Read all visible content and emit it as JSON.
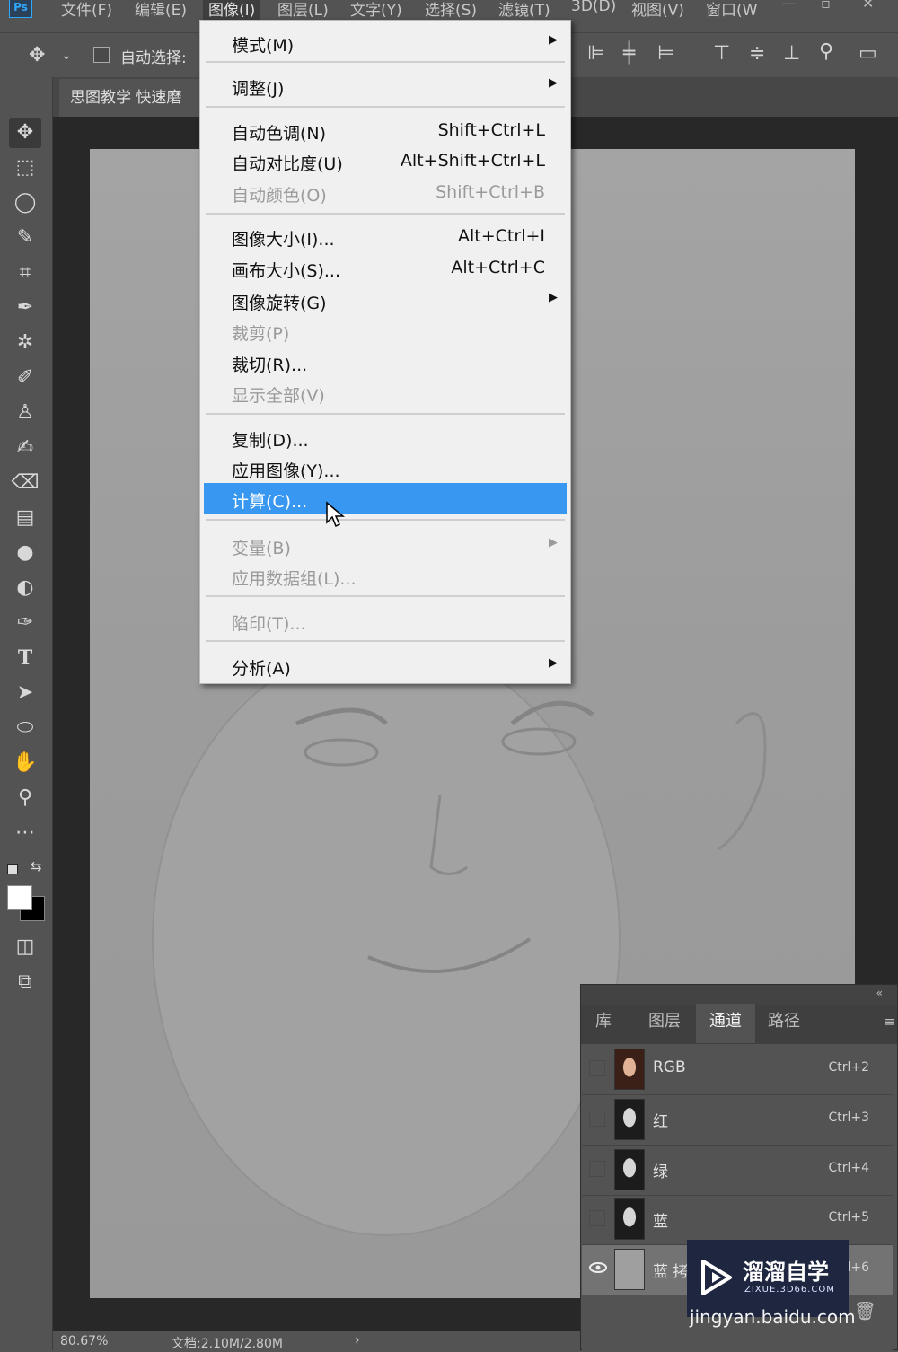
{
  "menubar": {
    "logo": "Ps",
    "items": [
      "文件(F)",
      "编辑(E)",
      "图像(I)",
      "图层(L)",
      "文字(Y)",
      "选择(S)",
      "滤镜(T)",
      "3D(D)",
      "视图(V)",
      "窗口(W"
    ],
    "active_index": 2
  },
  "options_bar": {
    "auto_select_label": "自动选择:"
  },
  "document": {
    "tab_title": "思图教学 快速磨"
  },
  "image_menu": {
    "items": [
      {
        "label": "模式(M)",
        "shortcut": "",
        "submenu": true,
        "disabled": false
      },
      {
        "label": "调整(J)",
        "shortcut": "",
        "submenu": true,
        "disabled": false
      },
      {
        "label": "自动色调(N)",
        "shortcut": "Shift+Ctrl+L",
        "submenu": false,
        "disabled": false
      },
      {
        "label": "自动对比度(U)",
        "shortcut": "Alt+Shift+Ctrl+L",
        "submenu": false,
        "disabled": false
      },
      {
        "label": "自动颜色(O)",
        "shortcut": "Shift+Ctrl+B",
        "submenu": false,
        "disabled": true
      },
      {
        "label": "图像大小(I)...",
        "shortcut": "Alt+Ctrl+I",
        "submenu": false,
        "disabled": false
      },
      {
        "label": "画布大小(S)...",
        "shortcut": "Alt+Ctrl+C",
        "submenu": false,
        "disabled": false
      },
      {
        "label": "图像旋转(G)",
        "shortcut": "",
        "submenu": true,
        "disabled": false
      },
      {
        "label": "裁剪(P)",
        "shortcut": "",
        "submenu": false,
        "disabled": true
      },
      {
        "label": "裁切(R)...",
        "shortcut": "",
        "submenu": false,
        "disabled": false
      },
      {
        "label": "显示全部(V)",
        "shortcut": "",
        "submenu": false,
        "disabled": true
      },
      {
        "label": "复制(D)...",
        "shortcut": "",
        "submenu": false,
        "disabled": false
      },
      {
        "label": "应用图像(Y)...",
        "shortcut": "",
        "submenu": false,
        "disabled": false
      },
      {
        "label": "计算(C)...",
        "shortcut": "",
        "submenu": false,
        "disabled": false,
        "highlighted": true
      },
      {
        "label": "变量(B)",
        "shortcut": "",
        "submenu": true,
        "disabled": true
      },
      {
        "label": "应用数据组(L)...",
        "shortcut": "",
        "submenu": false,
        "disabled": true
      },
      {
        "label": "陷印(T)...",
        "shortcut": "",
        "submenu": false,
        "disabled": true
      },
      {
        "label": "分析(A)",
        "shortcut": "",
        "submenu": true,
        "disabled": false
      }
    ]
  },
  "panel": {
    "tabs": [
      "库",
      "图层",
      "通道",
      "路径"
    ],
    "active_tab": 2,
    "channels": [
      {
        "name": "RGB",
        "shortcut": "Ctrl+2",
        "visible": false,
        "thumb": "color"
      },
      {
        "name": "红",
        "shortcut": "Ctrl+3",
        "visible": false,
        "thumb": "gray"
      },
      {
        "name": "绿",
        "shortcut": "Ctrl+4",
        "visible": false,
        "thumb": "gray"
      },
      {
        "name": "蓝",
        "shortcut": "Ctrl+5",
        "visible": false,
        "thumb": "gray"
      },
      {
        "name": "蓝 拷",
        "shortcut": "l+6",
        "visible": true,
        "thumb": "blank"
      }
    ]
  },
  "status": {
    "zoom": "80.67%",
    "doc_size": "文档:2.10M/2.80M"
  },
  "watermark": {
    "brand": "溜溜自学",
    "domain": "ZIXUE.3D66.COM",
    "caption": "jingyan.baidu.com"
  },
  "colors": {
    "menu_highlight": "#3797f1",
    "ui_bg": "#535353",
    "canvas_bg": "#282828"
  }
}
